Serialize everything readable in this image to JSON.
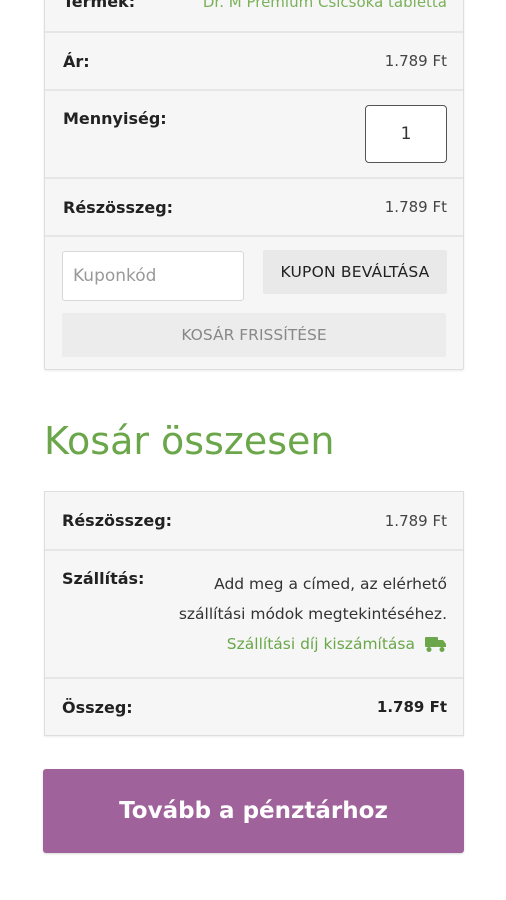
{
  "cart": {
    "product_label": "Termék:",
    "product_name": "Dr. M Premium Csicsóka tabletta",
    "price_label": "Ár:",
    "price_value": "1.789 Ft",
    "quantity_label": "Mennyiség:",
    "quantity_value": "1",
    "subtotal_label": "Részösszeg:",
    "subtotal_value": "1.789 Ft",
    "coupon_placeholder": "Kuponkód",
    "coupon_button": "KUPON BEVÁLTÁSA",
    "update_button": "KOSÁR FRISSÍTÉSE"
  },
  "totals": {
    "title": "Kosár összesen",
    "subtotal_label": "Részösszeg:",
    "subtotal_value": "1.789 Ft",
    "shipping_label": "Szállítás:",
    "shipping_note": "Add meg a címed, az elérhető szállítási módok megtekintéséhez.",
    "shipping_calc_link": "Szállítási díj kiszámítása",
    "total_label": "Összeg:",
    "total_value": "1.789 Ft"
  },
  "checkout_button": "Tovább a pénztárhoz",
  "colors": {
    "accent_green": "#6ba74a",
    "checkout_purple": "#a0629a"
  },
  "icons": {
    "shipping_calc": "truck-icon"
  }
}
